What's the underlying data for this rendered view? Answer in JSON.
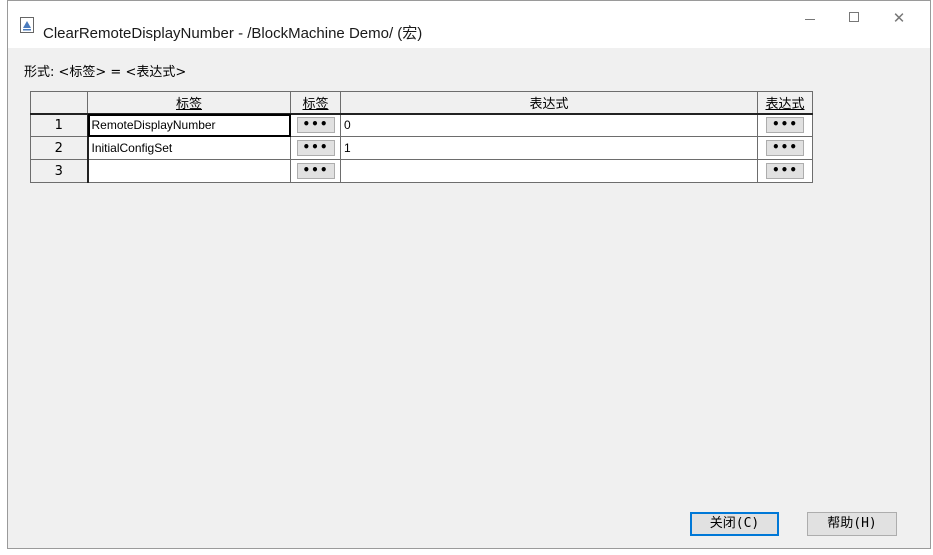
{
  "window": {
    "title": "ClearRemoteDisplayNumber - /BlockMachine Demo/ (宏)",
    "minimize": "–",
    "close": "✕"
  },
  "format_label": "形式: <标签> = <表达式>",
  "grid": {
    "headers": {
      "label": "标签",
      "label_btn": "标签",
      "expr": "表达式",
      "expr_btn": "表达式"
    },
    "browse_glyph": "•••",
    "rows": [
      {
        "num": "1",
        "label": "RemoteDisplayNumber",
        "expr": "0"
      },
      {
        "num": "2",
        "label": "InitialConfigSet",
        "expr": "1"
      },
      {
        "num": "3",
        "label": "",
        "expr": ""
      }
    ]
  },
  "buttons": {
    "close": "关闭(C)",
    "help": "帮助(H)"
  }
}
